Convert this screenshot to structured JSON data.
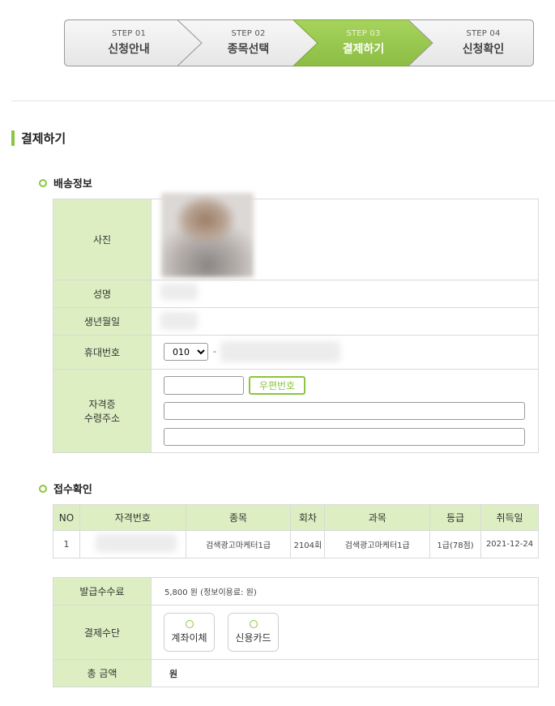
{
  "steps": [
    {
      "num": "STEP 01",
      "title": "신청안내"
    },
    {
      "num": "STEP 02",
      "title": "종목선택"
    },
    {
      "num": "STEP 03",
      "title": "결제하기"
    },
    {
      "num": "STEP 04",
      "title": "신청확인"
    }
  ],
  "page_title": "결제하기",
  "delivery": {
    "title": "배송정보",
    "labels": {
      "photo": "사진",
      "name": "성명",
      "birth": "생년월일",
      "phone": "휴대번호",
      "address_line1": "자격증",
      "address_line2": "수령주소"
    },
    "phone_prefix": "010",
    "phone_dash": "-",
    "zip_button": "우편번호"
  },
  "receipt": {
    "title": "접수확인",
    "headers": [
      "NO",
      "자격번호",
      "종목",
      "회차",
      "과목",
      "등급",
      "취득일"
    ],
    "rows": [
      {
        "no": "1",
        "license_no": "",
        "category": "검색광고마케터1급",
        "round": "2104회",
        "subject": "검색광고마케터1급",
        "grade": "1급(78점)",
        "date": "2021-12-24"
      }
    ]
  },
  "payment": {
    "fee_label": "발급수수료",
    "fee_value": "5,800  원 (정보이용료: 원)",
    "method_label": "결제수단",
    "methods": [
      "계좌이체",
      "신용카드"
    ],
    "total_label": "총 금액",
    "total_value": "원"
  },
  "colors": {
    "accent": "#8cc540",
    "header_bg": "#ddefc2",
    "step_active": "#95c84a"
  }
}
